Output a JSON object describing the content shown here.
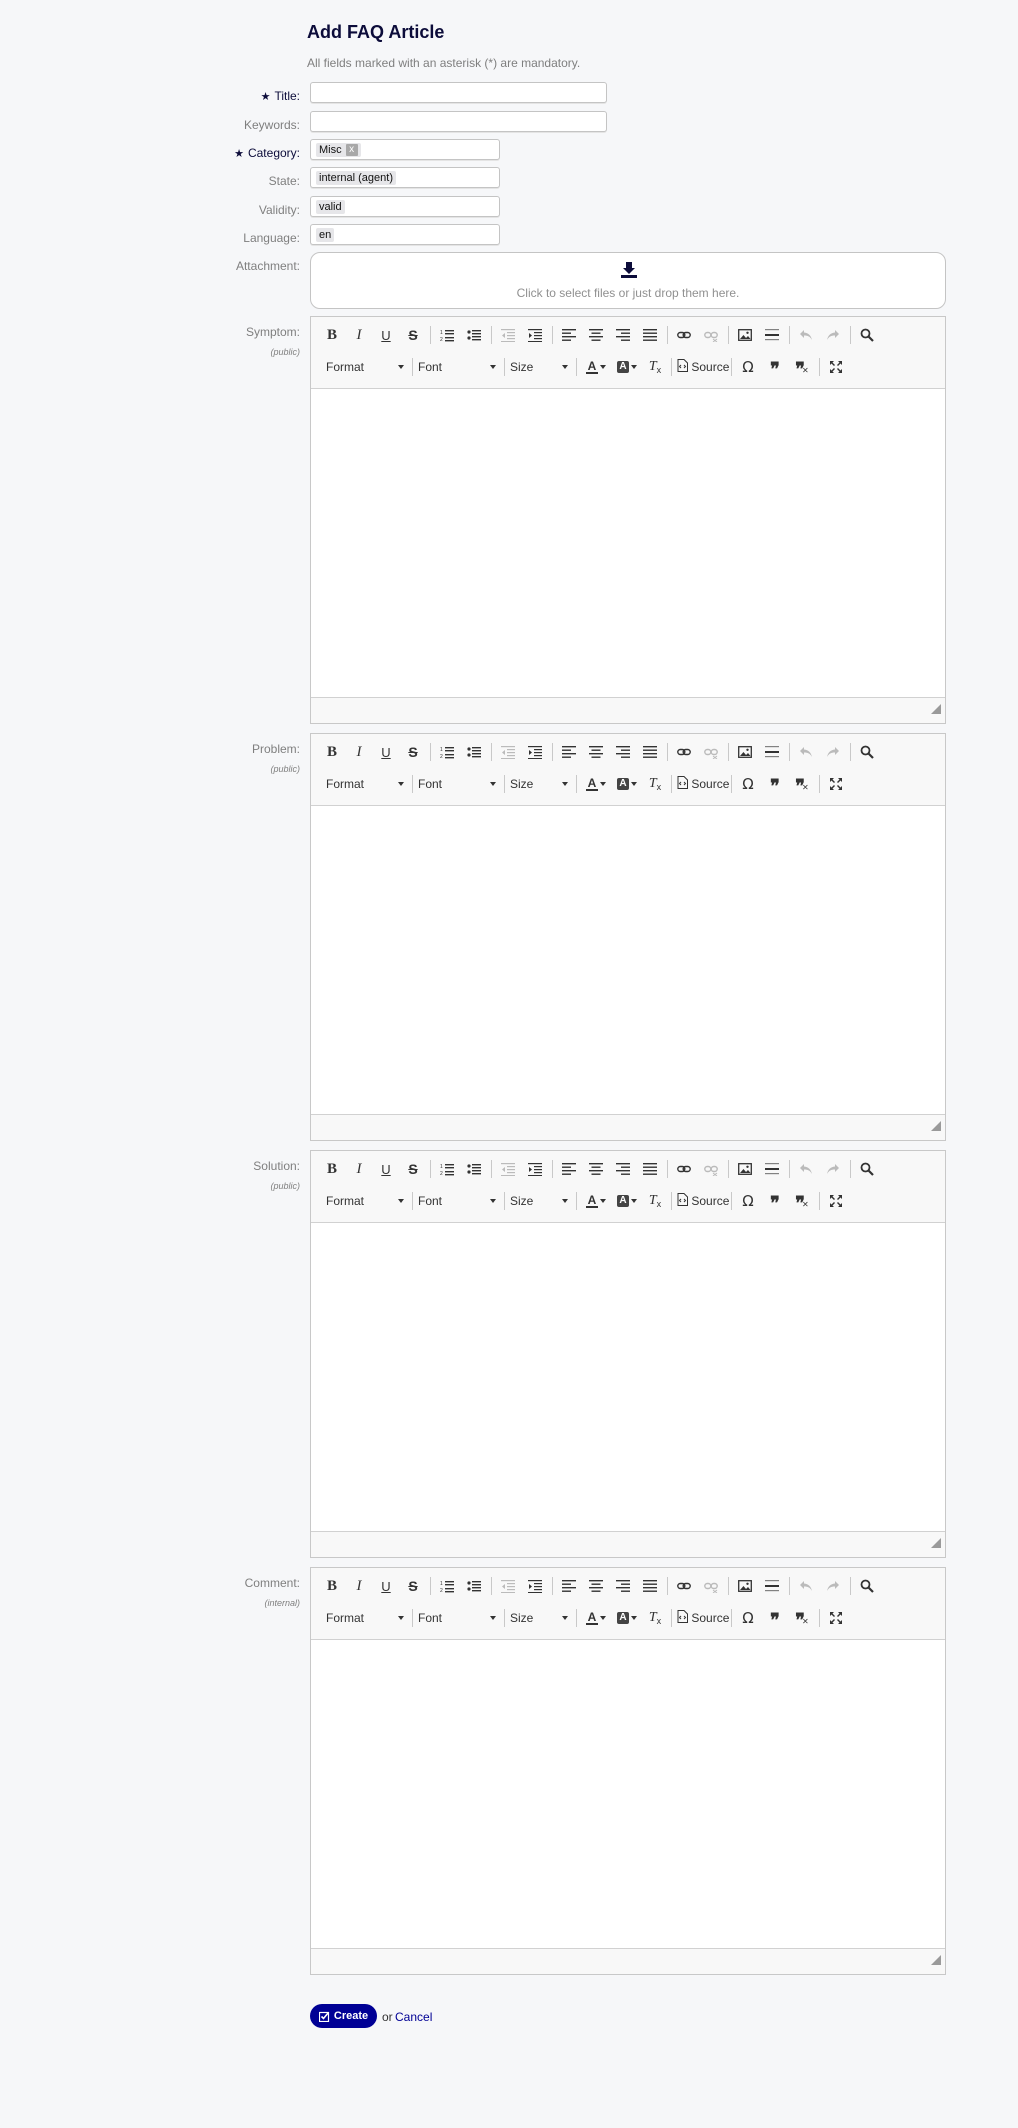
{
  "page": {
    "title": "Add FAQ Article",
    "mandatory_note": "All fields marked with an asterisk (*) are mandatory."
  },
  "fields": {
    "title_label": "Title:",
    "keywords_label": "Keywords:",
    "category_label": "Category:",
    "category_value": "Misc",
    "category_remove": "x",
    "state_label": "State:",
    "state_value": "internal (agent)",
    "validity_label": "Validity:",
    "validity_value": "valid",
    "language_label": "Language:",
    "language_value": "en",
    "attachment_label": "Attachment:",
    "attachment_hint": "Click to select files or just drop them here.",
    "required_star": "★"
  },
  "editors": [
    {
      "label": "Symptom:",
      "visibility": "(public)"
    },
    {
      "label": "Problem:",
      "visibility": "(public)"
    },
    {
      "label": "Solution:",
      "visibility": "(public)"
    },
    {
      "label": "Comment:",
      "visibility": "(internal)"
    }
  ],
  "toolbar": {
    "format": "Format",
    "font": "Font",
    "size": "Size",
    "source": "Source",
    "icons": [
      "bold-icon",
      "italic-icon",
      "underline-icon",
      "strikethrough-icon",
      "numbered-list-icon",
      "bulleted-list-icon",
      "outdent-icon",
      "indent-icon",
      "align-left-icon",
      "align-center-icon",
      "align-right-icon",
      "justify-icon",
      "link-icon",
      "unlink-icon",
      "image-icon",
      "horizontal-line-icon",
      "undo-icon",
      "redo-icon",
      "find-icon",
      "text-color-icon",
      "background-color-icon",
      "remove-format-icon",
      "special-char-icon",
      "blockquote-icon",
      "remove-blockquote-icon",
      "maximize-icon"
    ]
  },
  "actions": {
    "create_label": "Create",
    "or_text": "or",
    "cancel_label": "Cancel"
  },
  "colors": {
    "brand": "#000095",
    "title": "#0c0c3a",
    "background": "#f6f7f9"
  }
}
